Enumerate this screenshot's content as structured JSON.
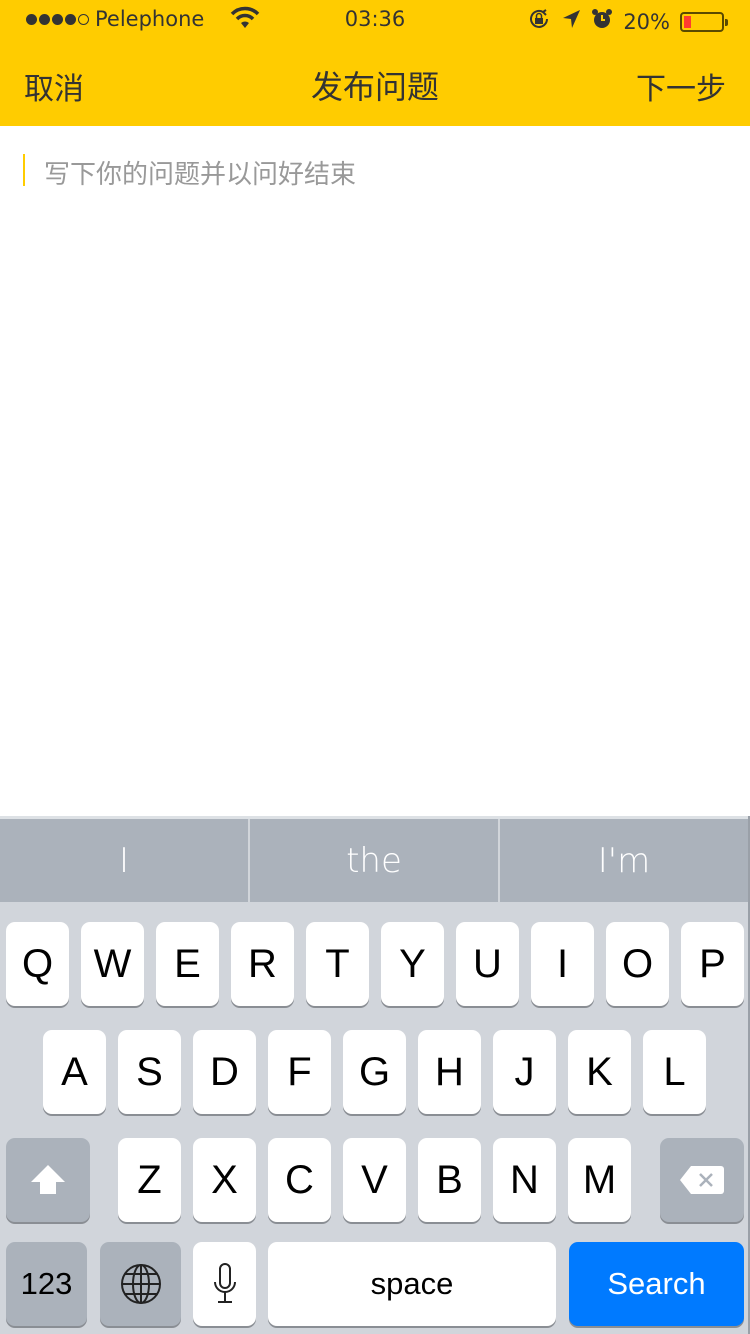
{
  "status_bar": {
    "signal_bars_filled": 4,
    "signal_bars_total": 5,
    "carrier": "Pelephone",
    "time": "03:36",
    "icons": [
      "wifi-icon",
      "rotation-lock-icon",
      "location-arrow-icon",
      "alarm-icon"
    ],
    "battery_percent_text": "20%",
    "battery_level": 0.2,
    "battery_color": "#ff3b30"
  },
  "nav": {
    "cancel_label": "取消",
    "title": "发布问题",
    "next_label": "下一步",
    "background": "#ffcc00"
  },
  "editor": {
    "placeholder": "写下你的问题并以问好结束",
    "value": ""
  },
  "keyboard": {
    "predictions": [
      "I",
      "the",
      "I'm"
    ],
    "row1": [
      "Q",
      "W",
      "E",
      "R",
      "T",
      "Y",
      "U",
      "I",
      "O",
      "P"
    ],
    "row2": [
      "A",
      "S",
      "D",
      "F",
      "G",
      "H",
      "J",
      "K",
      "L"
    ],
    "row3": [
      "Z",
      "X",
      "C",
      "V",
      "B",
      "N",
      "M"
    ],
    "numbers_label": "123",
    "space_label": "space",
    "return_label": "Search",
    "return_color": "#007aff"
  }
}
